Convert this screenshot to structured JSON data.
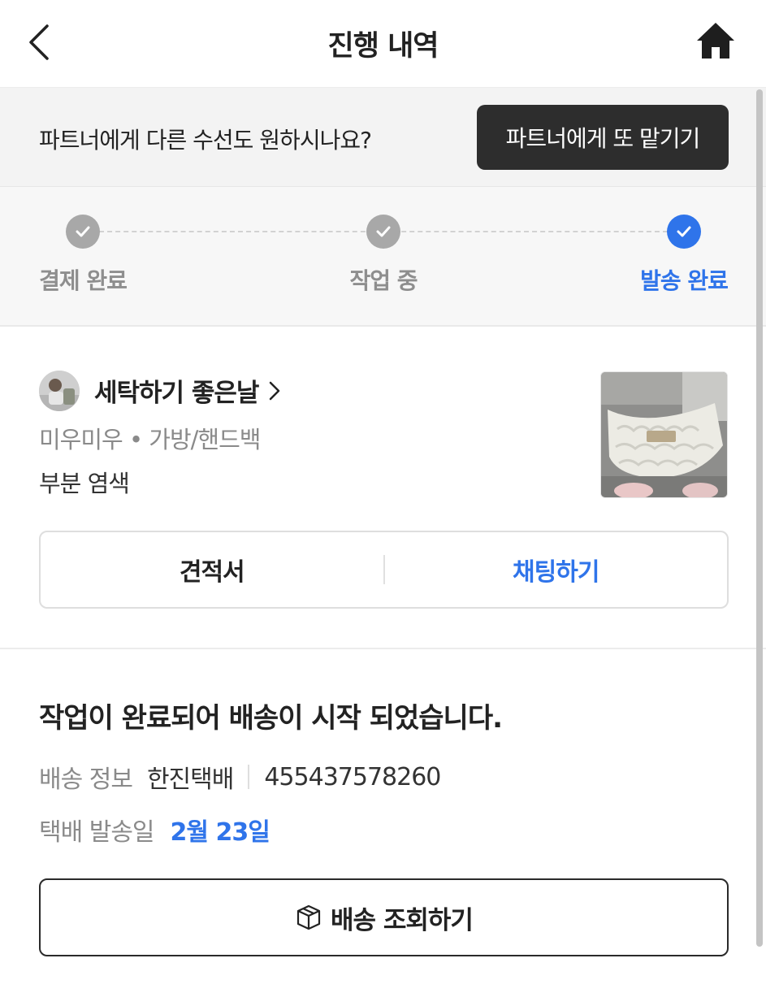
{
  "header": {
    "title": "진행 내역",
    "back_icon": "chevron-left-icon",
    "home_icon": "home-icon"
  },
  "banner": {
    "text": "파트너에게 다른 수선도 원하시나요?",
    "button_label": "파트너에게 또 맡기기"
  },
  "progress": {
    "steps": [
      {
        "label": "결제 완료",
        "state": "done"
      },
      {
        "label": "작업 중",
        "state": "done"
      },
      {
        "label": "발송 완료",
        "state": "current"
      }
    ],
    "colors": {
      "done": "#a8a8a8",
      "current": "#2f74ea"
    }
  },
  "order": {
    "shop_name": "세탁하기 좋은날",
    "category": "미우미우 • 가방/핸드백",
    "service": "부분 염색",
    "quote_label": "견적서",
    "chat_label": "채팅하기"
  },
  "shipping": {
    "message": "작업이 완료되어 배송이 시작 되었습니다.",
    "info_label": "배송 정보",
    "carrier": "한진택배",
    "tracking_number": "455437578260",
    "date_label": "택배 발송일",
    "date_value": "2월 23일",
    "track_button_label": "배송 조회하기",
    "track_icon": "package-icon"
  },
  "colors": {
    "accent": "#2f74ea",
    "dark_button": "#2d2d2d"
  }
}
